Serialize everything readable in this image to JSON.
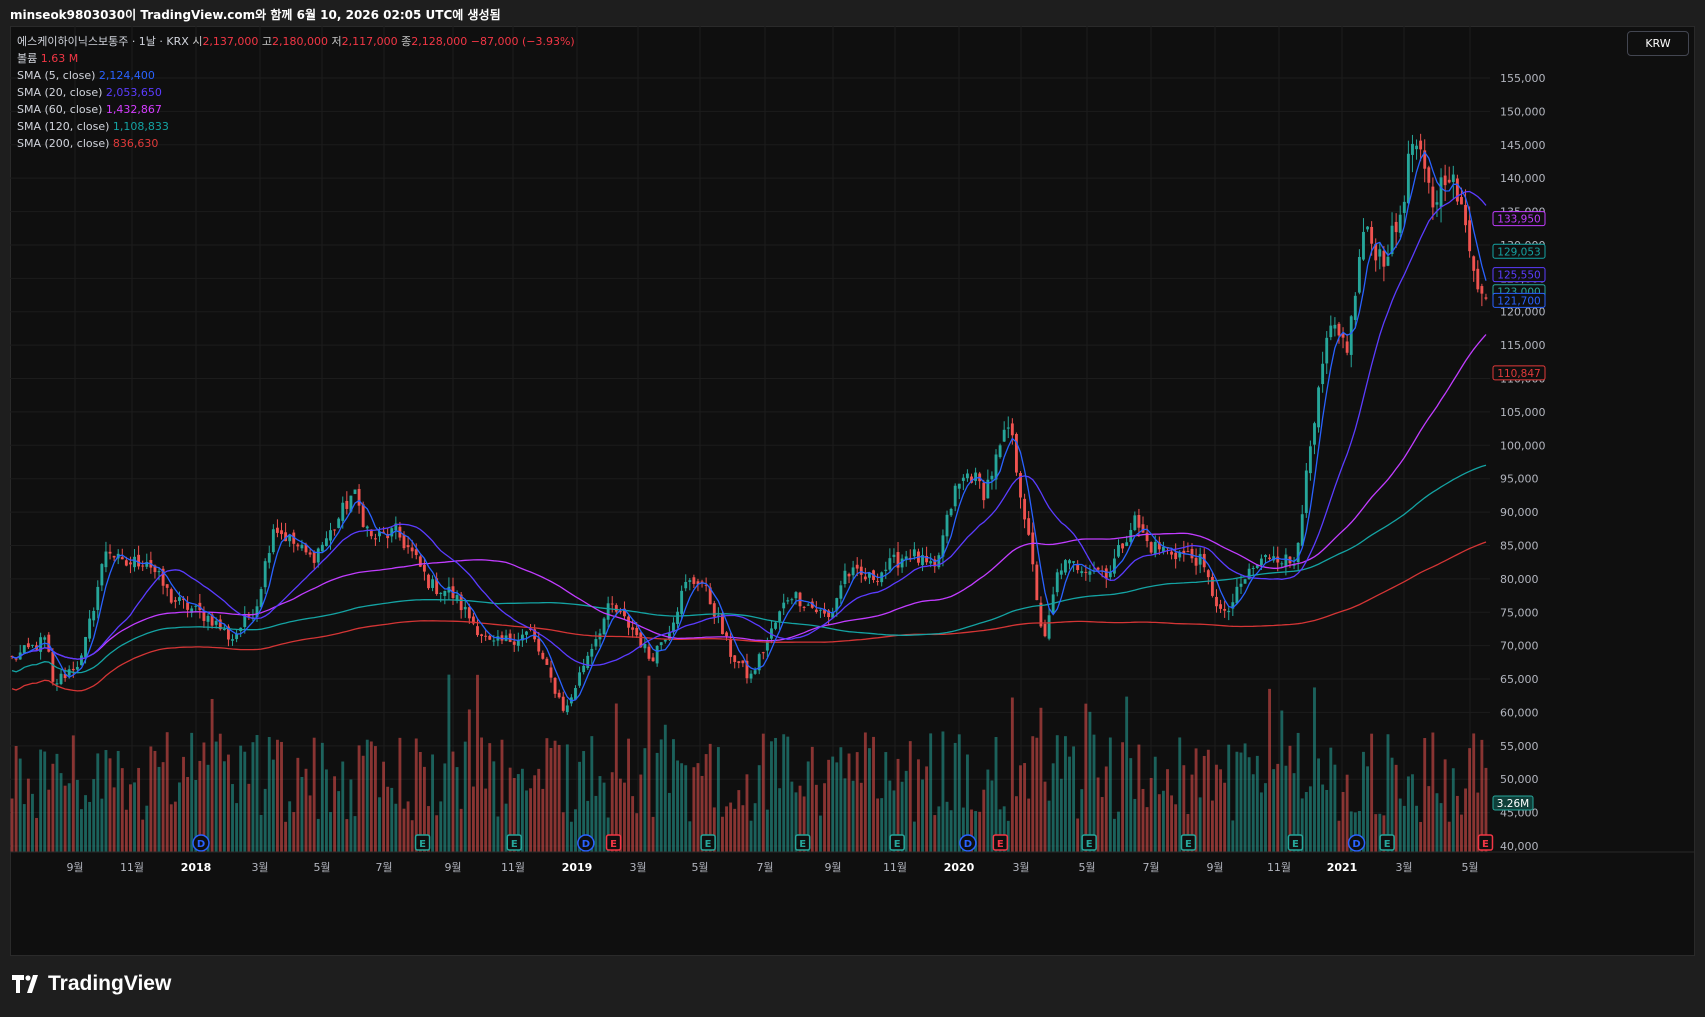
{
  "header": {
    "snapshot_text": "minseok9803030이 TradingView.com와 함께 6월 10, 2026 02:05 UTC에 생성됨"
  },
  "legend": {
    "symbol": "에스케이하이닉스보통주 · 1날 · KRX",
    "o_label": "시",
    "o_value": "2,137,000",
    "h_label": "고",
    "h_value": "2,180,000",
    "l_label": "저",
    "l_value": "2,117,000",
    "c_label": "종",
    "c_value": "2,128,000",
    "change": "−87,000 (−3.93%)",
    "volume_label": "볼륨",
    "volume_value": "1.63 M",
    "sma": [
      {
        "label": "SMA (5, close)",
        "value": "2,124,400",
        "color": "#2962ff"
      },
      {
        "label": "SMA (20, close)",
        "value": "2,053,650",
        "color": "#5b3cff"
      },
      {
        "label": "SMA (60, close)",
        "value": "1,432,867",
        "color": "#d43cff"
      },
      {
        "label": "SMA (120, close)",
        "value": "1,108,833",
        "color": "#14a3a3"
      },
      {
        "label": "SMA (200, close)",
        "value": "836,630",
        "color": "#e03a3a"
      }
    ]
  },
  "currency_button": "KRW",
  "brand": "TradingView",
  "colors": {
    "up": "#26a69a",
    "down": "#ef5350",
    "background": "#0f0f0f",
    "grid": "#1c1c1c",
    "sma5": "#2962ff",
    "sma20": "#5b3cff",
    "sma60": "#c13cff",
    "sma120": "#14a3a3",
    "sma200": "#d43535"
  },
  "chart_data": {
    "type": "candlestick",
    "ylim": [
      40000,
      157000
    ],
    "y_ticks": [
      "155,000",
      "150,000",
      "145,000",
      "140,000",
      "135,000",
      "130,000",
      "125,000",
      "120,000",
      "115,000",
      "110,000",
      "105,000",
      "100,000",
      "95,000",
      "90,000",
      "85,000",
      "80,000",
      "75,000",
      "70,000",
      "65,000",
      "60,000",
      "55,000",
      "50,000",
      "45,000",
      "40,000"
    ],
    "x_ticks": [
      "9월",
      "11월",
      "2018",
      "3월",
      "5월",
      "7월",
      "9월",
      "11월",
      "2019",
      "3월",
      "5월",
      "7월",
      "9월",
      "11월",
      "2020",
      "3월",
      "5월",
      "7월",
      "9월",
      "11월",
      "2021",
      "3월",
      "5월"
    ],
    "x_tick_bold": [
      false,
      false,
      true,
      false,
      false,
      false,
      false,
      false,
      true,
      false,
      false,
      false,
      false,
      false,
      true,
      false,
      false,
      false,
      false,
      false,
      true,
      false,
      false
    ],
    "close_anchors": [
      [
        0,
        68000
      ],
      [
        0.035,
        71000
      ],
      [
        0.04,
        64000
      ],
      [
        0.07,
        68000
      ],
      [
        0.095,
        85000
      ],
      [
        0.11,
        82000
      ],
      [
        0.135,
        83000
      ],
      [
        0.16,
        77000
      ],
      [
        0.2,
        74000
      ],
      [
        0.22,
        71000
      ],
      [
        0.245,
        76000
      ],
      [
        0.262,
        88000
      ],
      [
        0.3,
        83000
      ],
      [
        0.32,
        87000
      ],
      [
        0.342,
        93000
      ],
      [
        0.36,
        86000
      ],
      [
        0.385,
        87000
      ],
      [
        0.4,
        84000
      ],
      [
        0.42,
        79000
      ],
      [
        0.44,
        78000
      ],
      [
        0.48,
        70000
      ],
      [
        0.52,
        72000
      ],
      [
        0.54,
        65000
      ],
      [
        0.555,
        60000
      ],
      [
        0.575,
        68000
      ],
      [
        0.6,
        76000
      ],
      [
        0.625,
        72000
      ],
      [
        0.64,
        68000
      ],
      [
        0.66,
        73000
      ],
      [
        0.675,
        79000
      ],
      [
        0.69,
        80000
      ],
      [
        0.705,
        75000
      ],
      [
        0.72,
        69000
      ],
      [
        0.74,
        65000
      ],
      [
        0.755,
        70000
      ],
      [
        0.78,
        78000
      ],
      [
        0.8,
        76000
      ],
      [
        0.82,
        74000
      ],
      [
        0.835,
        81000
      ],
      [
        0.86,
        80000
      ],
      [
        0.9,
        84000
      ],
      [
        0.925,
        81000
      ],
      [
        0.945,
        93000
      ],
      [
        0.96,
        96000
      ],
      [
        0.975,
        93000
      ],
      [
        1.0,
        103000
      ],
      [
        1.015,
        90000
      ],
      [
        1.035,
        70000
      ],
      [
        1.05,
        82000
      ],
      [
        1.075,
        82000
      ],
      [
        1.1,
        81000
      ],
      [
        1.125,
        89000
      ],
      [
        1.14,
        85000
      ],
      [
        1.165,
        84000
      ],
      [
        1.19,
        83000
      ],
      [
        1.215,
        74000
      ],
      [
        1.24,
        81000
      ],
      [
        1.265,
        84000
      ],
      [
        1.285,
        82000
      ],
      [
        1.3,
        97000
      ],
      [
        1.32,
        117000
      ],
      [
        1.34,
        115000
      ],
      [
        1.355,
        132000
      ],
      [
        1.375,
        128000
      ],
      [
        1.39,
        133000
      ],
      [
        1.405,
        146000
      ],
      [
        1.425,
        136000
      ],
      [
        1.44,
        142000
      ],
      [
        1.46,
        131000
      ],
      [
        1.475,
        121700
      ]
    ],
    "sma_last": {
      "sma5": 121700,
      "sma20": 125550,
      "sma60": 133950,
      "sma120": 129053,
      "sma200": 110847,
      "close": 123000
    },
    "last_labels": [
      {
        "text": "133,950",
        "key": "sma60"
      },
      {
        "text": "129,053",
        "key": "sma120"
      },
      {
        "text": "125,550",
        "key": "sma20"
      },
      {
        "text": "123,000",
        "key": "up"
      },
      {
        "text": "121,700",
        "key": "sma5"
      },
      {
        "text": "110,847",
        "key": "sma200"
      }
    ],
    "volume_label": "3.26M",
    "event_markers": [
      {
        "type": "D",
        "pos": 0.2
      },
      {
        "type": "E",
        "pos": 0.432
      },
      {
        "type": "E",
        "pos": 0.528
      },
      {
        "type": "D",
        "pos": 0.603
      },
      {
        "type": "E",
        "pos": 0.632
      },
      {
        "type": "E",
        "pos": 0.731
      },
      {
        "type": "E",
        "pos": 0.83
      },
      {
        "type": "E",
        "pos": 0.929
      },
      {
        "type": "D",
        "pos": 1.003
      },
      {
        "type": "E",
        "pos": 1.037
      },
      {
        "type": "E",
        "pos": 1.13
      },
      {
        "type": "E",
        "pos": 1.234
      },
      {
        "type": "E",
        "pos": 1.346
      },
      {
        "type": "D",
        "pos": 1.41
      },
      {
        "type": "E",
        "pos": 1.442
      },
      {
        "type": "E",
        "pos": 1.545
      }
    ]
  }
}
